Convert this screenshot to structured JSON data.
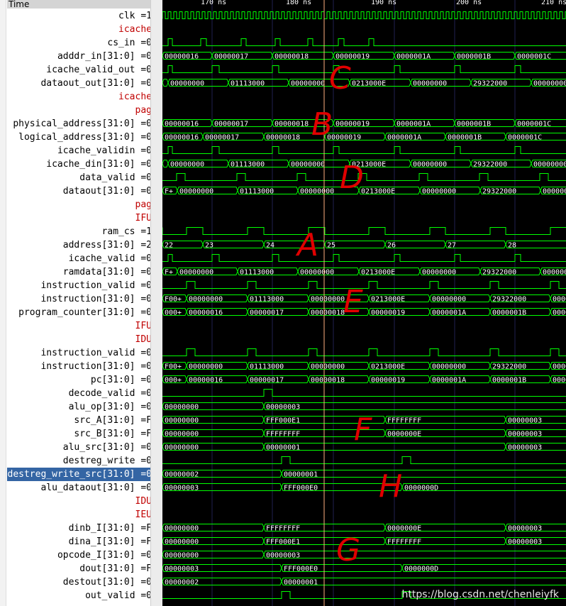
{
  "header": {
    "time_label": "Time"
  },
  "timescale": {
    "ticks": [
      "170 ns",
      "180 ns",
      "190 ns",
      "200 ns",
      "210 ns"
    ]
  },
  "cursor_color": "#ffb080",
  "grid_color": "#202050",
  "wave_color": "#00ff00",
  "group_color": "#c00000",
  "signals": [
    {
      "label": "clk =1",
      "kind": "clk"
    },
    {
      "label": "icache",
      "kind": "group"
    },
    {
      "label": "cs_in =0",
      "kind": "bit",
      "pulses": [
        [
          8,
          14
        ],
        [
          54,
          62
        ],
        [
          111,
          118
        ],
        [
          159,
          166
        ],
        [
          205,
          212
        ],
        [
          248,
          256
        ],
        [
          291,
          298
        ]
      ]
    },
    {
      "label": "adddr_in[31:0] =0",
      "kind": "bus",
      "segments": [
        [
          "00000016",
          0
        ],
        [
          "00000017",
          70
        ],
        [
          "00000018",
          155
        ],
        [
          "00000019",
          241
        ],
        [
          "0000001A",
          327
        ],
        [
          "0000001B",
          412
        ],
        [
          "0000001C",
          497
        ]
      ]
    },
    {
      "label": "icache_valid_out =0",
      "kind": "bit",
      "pulses": [
        [
          8,
          14
        ],
        [
          70,
          80
        ],
        [
          155,
          164
        ],
        [
          241,
          249
        ],
        [
          327,
          335
        ],
        [
          412,
          420
        ],
        [
          497,
          505
        ]
      ]
    },
    {
      "label": "dataout_out[31:0] =0",
      "kind": "bus",
      "segments": [
        [
          "",
          0
        ],
        [
          "00000000",
          8
        ],
        [
          "01113000",
          93
        ],
        [
          "00000000",
          178
        ],
        [
          "0213000E",
          264
        ],
        [
          "00000000",
          350
        ],
        [
          "29322000",
          435
        ],
        [
          "00000000",
          520
        ]
      ]
    },
    {
      "label": "icache",
      "kind": "group"
    },
    {
      "label": "pag",
      "kind": "group"
    },
    {
      "label": "physical_address[31:0] =0",
      "kind": "bus",
      "segments": [
        [
          "00000016",
          0
        ],
        [
          "00000017",
          70
        ],
        [
          "00000018",
          155
        ],
        [
          "00000019",
          241
        ],
        [
          "0000001A",
          327
        ],
        [
          "0000001B",
          412
        ],
        [
          "0000001C",
          497
        ]
      ]
    },
    {
      "label": "logical_address[31:0] =0",
      "kind": "bus",
      "segments": [
        [
          "00000016",
          0
        ],
        [
          "00000017",
          57
        ],
        [
          "00000018",
          143
        ],
        [
          "00000019",
          229
        ],
        [
          "0000001A",
          314
        ],
        [
          "0000001B",
          399
        ],
        [
          "0000001C",
          484
        ]
      ]
    },
    {
      "label": "icache_validin =0",
      "kind": "bit",
      "pulses": [
        [
          8,
          14
        ],
        [
          70,
          80
        ],
        [
          155,
          164
        ],
        [
          241,
          249
        ],
        [
          327,
          335
        ],
        [
          412,
          420
        ],
        [
          497,
          505
        ]
      ]
    },
    {
      "label": "icache_din[31:0] =0",
      "kind": "bus",
      "segments": [
        [
          "",
          0
        ],
        [
          "00000000",
          8
        ],
        [
          "01113000",
          93
        ],
        [
          "00000000",
          178
        ],
        [
          "0213000E",
          264
        ],
        [
          "00000000",
          350
        ],
        [
          "29322000",
          435
        ],
        [
          "00000000",
          520
        ]
      ]
    },
    {
      "label": "data_valid =0",
      "kind": "bit",
      "pulses": [
        [
          20,
          32
        ],
        [
          105,
          117
        ],
        [
          190,
          202
        ],
        [
          276,
          288
        ],
        [
          362,
          374
        ],
        [
          447,
          459
        ],
        [
          532,
          544
        ]
      ]
    },
    {
      "label": "dataout[31:0] =0",
      "kind": "bus",
      "segments": [
        [
          "F+",
          0
        ],
        [
          "00000000",
          21
        ],
        [
          "01113000",
          106
        ],
        [
          "00000000",
          191
        ],
        [
          "0213000E",
          277
        ],
        [
          "00000000",
          363
        ],
        [
          "29322000",
          448
        ],
        [
          "00000000",
          533
        ]
      ]
    },
    {
      "label": "pag",
      "kind": "group"
    },
    {
      "label": "IFU",
      "kind": "group"
    },
    {
      "label": "ram_cs =1",
      "kind": "bit",
      "pulses": [
        [
          0,
          34
        ],
        [
          57,
          120
        ],
        [
          143,
          206
        ],
        [
          229,
          291
        ],
        [
          314,
          377
        ],
        [
          399,
          462
        ],
        [
          484,
          547
        ]
      ],
      "invert": true
    },
    {
      "label": "address[31:0] =2",
      "kind": "bus",
      "segments": [
        [
          "22",
          0
        ],
        [
          "23",
          57
        ],
        [
          "24",
          143
        ],
        [
          "25",
          229
        ],
        [
          "26",
          314
        ],
        [
          "27",
          399
        ],
        [
          "28",
          484
        ]
      ]
    },
    {
      "label": "icache_valid =0",
      "kind": "bit",
      "pulses": [
        [
          8,
          14
        ],
        [
          70,
          80
        ],
        [
          155,
          164
        ],
        [
          241,
          249
        ],
        [
          327,
          335
        ],
        [
          412,
          420
        ],
        [
          497,
          505
        ]
      ]
    },
    {
      "label": "ramdata[31:0] =0",
      "kind": "bus",
      "segments": [
        [
          "F+",
          0
        ],
        [
          "00000000",
          21
        ],
        [
          "01113000",
          106
        ],
        [
          "00000000",
          191
        ],
        [
          "0213000E",
          277
        ],
        [
          "00000000",
          363
        ],
        [
          "29322000",
          448
        ],
        [
          "00000000",
          533
        ]
      ]
    },
    {
      "label": "instruction_valid =0",
      "kind": "bit",
      "pulses": [
        [
          34,
          46
        ],
        [
          120,
          132
        ],
        [
          206,
          218
        ],
        [
          291,
          303
        ],
        [
          377,
          389
        ],
        [
          462,
          474
        ],
        [
          547,
          559
        ]
      ]
    },
    {
      "label": "instruction[31:0] =0",
      "kind": "bus",
      "segments": [
        [
          "F00+",
          0
        ],
        [
          "00000000",
          34
        ],
        [
          "01113000",
          120
        ],
        [
          "00000000",
          206
        ],
        [
          "0213000E",
          291
        ],
        [
          "00000000",
          377
        ],
        [
          "29322000",
          462
        ],
        [
          "0000",
          547
        ]
      ]
    },
    {
      "label": "program_counter[31:0] =0",
      "kind": "bus",
      "segments": [
        [
          "000+",
          0
        ],
        [
          "00000016",
          34
        ],
        [
          "00000017",
          120
        ],
        [
          "00000018",
          206
        ],
        [
          "00000019",
          291
        ],
        [
          "0000001A",
          377
        ],
        [
          "0000001B",
          462
        ],
        [
          "0000",
          547
        ]
      ]
    },
    {
      "label": "IFU",
      "kind": "group"
    },
    {
      "label": "IDU",
      "kind": "group"
    },
    {
      "label": "instruction_valid =0",
      "kind": "bit",
      "pulses": [
        [
          34,
          46
        ],
        [
          120,
          132
        ],
        [
          206,
          218
        ],
        [
          291,
          303
        ],
        [
          377,
          389
        ],
        [
          462,
          474
        ],
        [
          547,
          559
        ]
      ]
    },
    {
      "label": "instruction[31:0] =0",
      "kind": "bus",
      "segments": [
        [
          "F00+",
          0
        ],
        [
          "00000000",
          34
        ],
        [
          "01113000",
          120
        ],
        [
          "00000000",
          206
        ],
        [
          "0213000E",
          291
        ],
        [
          "00000000",
          377
        ],
        [
          "29322000",
          462
        ],
        [
          "0000",
          547
        ]
      ]
    },
    {
      "label": "pc[31:0] =0",
      "kind": "bus",
      "segments": [
        [
          "000+",
          0
        ],
        [
          "00000016",
          34
        ],
        [
          "00000017",
          120
        ],
        [
          "00000018",
          206
        ],
        [
          "00000019",
          291
        ],
        [
          "0000001A",
          377
        ],
        [
          "0000001B",
          462
        ],
        [
          "0000",
          547
        ]
      ]
    },
    {
      "label": "decode_valid =0",
      "kind": "bit",
      "pulses": [
        [
          143,
          155
        ]
      ]
    },
    {
      "label": "alu_op[31:0] =0",
      "kind": "bus",
      "segments": [
        [
          "00000000",
          0
        ],
        [
          "00000003",
          143
        ]
      ]
    },
    {
      "label": "src_A[31:0] =F",
      "kind": "bus",
      "segments": [
        [
          "00000000",
          0
        ],
        [
          "FFF000E1",
          143
        ],
        [
          "FFFFFFFF",
          314
        ],
        [
          "00000003",
          484
        ]
      ]
    },
    {
      "label": "src_B[31:0] =F",
      "kind": "bus",
      "segments": [
        [
          "00000000",
          0
        ],
        [
          "FFFFFFFF",
          143
        ],
        [
          "0000000E",
          314
        ],
        [
          "00000003",
          484
        ]
      ]
    },
    {
      "label": "alu_src[31:0] =0",
      "kind": "bus",
      "segments": [
        [
          "00000000",
          0
        ],
        [
          "00000001",
          143
        ],
        [
          "00000003",
          484
        ]
      ]
    },
    {
      "label": "destreg_write =0",
      "kind": "bit",
      "pulses": [
        [
          168,
          180
        ],
        [
          338,
          350
        ]
      ]
    },
    {
      "label": "destreg_write_src[31:0] =0",
      "kind": "bus",
      "selected": true,
      "segments": [
        [
          "00000002",
          0
        ],
        [
          "00000001",
          168
        ]
      ]
    },
    {
      "label": "alu_dataout[31:0] =0",
      "kind": "bus",
      "segments": [
        [
          "00000003",
          0
        ],
        [
          "FFF000E0",
          168
        ],
        [
          "0000000D",
          338
        ]
      ]
    },
    {
      "label": "IDU",
      "kind": "group"
    },
    {
      "label": "IEU",
      "kind": "group"
    },
    {
      "label": "dinb_I[31:0] =F",
      "kind": "bus",
      "segments": [
        [
          "00000000",
          0
        ],
        [
          "FFFFFFFF",
          143
        ],
        [
          "0000000E",
          314
        ],
        [
          "00000003",
          484
        ]
      ]
    },
    {
      "label": "dina_I[31:0] =F",
      "kind": "bus",
      "segments": [
        [
          "00000000",
          0
        ],
        [
          "FFF000E1",
          143
        ],
        [
          "FFFFFFFF",
          314
        ],
        [
          "00000003",
          484
        ]
      ]
    },
    {
      "label": "opcode_I[31:0] =0",
      "kind": "bus",
      "segments": [
        [
          "00000000",
          0
        ],
        [
          "00000003",
          143
        ]
      ]
    },
    {
      "label": "dout[31:0] =F",
      "kind": "bus",
      "segments": [
        [
          "00000003",
          0
        ],
        [
          "FFF000E0",
          168
        ],
        [
          "0000000D",
          338
        ]
      ]
    },
    {
      "label": "destout[31:0] =0",
      "kind": "bus",
      "segments": [
        [
          "00000002",
          0
        ],
        [
          "00000001",
          168
        ]
      ]
    },
    {
      "label": "out_valid =0",
      "kind": "bit",
      "pulses": [
        [
          168,
          180
        ],
        [
          338,
          350
        ]
      ]
    }
  ],
  "annotations": [
    {
      "text": "C"
    },
    {
      "text": "B"
    },
    {
      "text": "D"
    },
    {
      "text": "A"
    },
    {
      "text": "E"
    },
    {
      "text": "F"
    },
    {
      "text": "H"
    },
    {
      "text": "G"
    }
  ],
  "watermark": "https://blog.csdn.net/chenleiyfk"
}
